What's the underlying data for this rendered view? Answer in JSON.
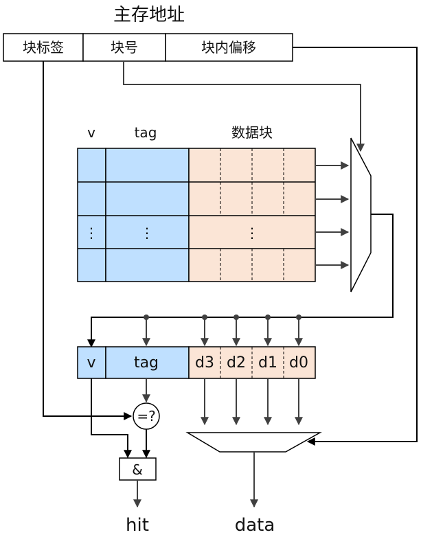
{
  "address": {
    "title": "主存地址",
    "fields": [
      "块标签",
      "块号",
      "块内偏移"
    ]
  },
  "cache_table": {
    "headers": {
      "valid": "v",
      "tag": "tag",
      "data": "数据块"
    },
    "ellipsis": "⋮"
  },
  "selected_line": {
    "valid": "v",
    "tag": "tag",
    "words": [
      "d3",
      "d2",
      "d1",
      "d0"
    ]
  },
  "logic": {
    "comparator": "=?",
    "and_gate": "&"
  },
  "outputs": {
    "hit": "hit",
    "data": "data"
  },
  "colors": {
    "valid_fill": "#BFE0FF",
    "tag_fill": "#BFE0FF",
    "data_fill": "#FBE5D6",
    "wire": "#404040"
  }
}
